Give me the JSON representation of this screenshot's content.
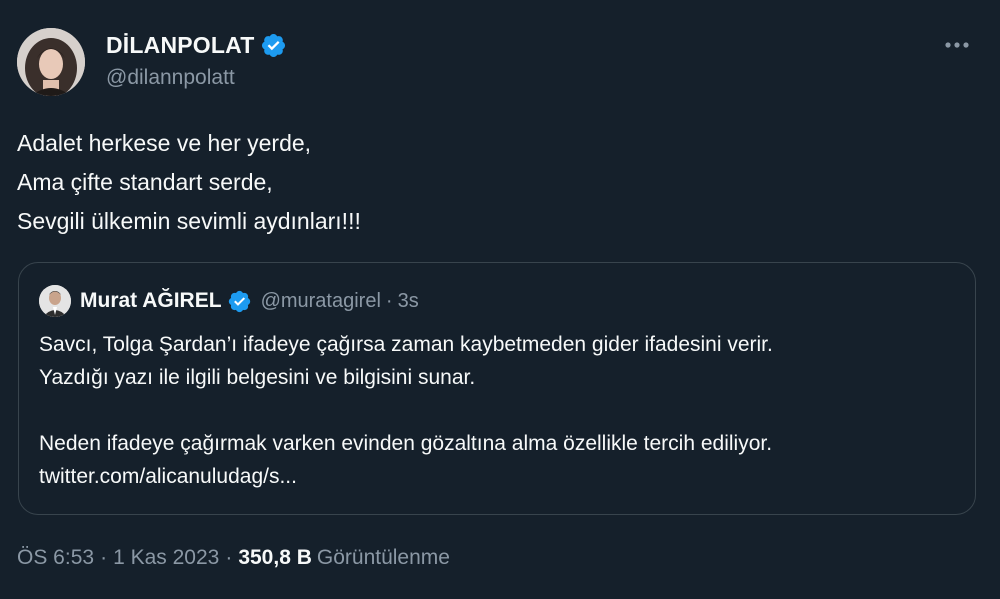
{
  "author": {
    "name": "DİLANPOLAT",
    "handle": "@dilannpolatt",
    "verified": true
  },
  "tweet": {
    "lines": [
      "Adalet herkese ve her yerde,",
      "Ama çifte standart serde,",
      "Sevgili ülkemin sevimli aydınları!!!"
    ]
  },
  "quote": {
    "name": "Murat AĞIREL",
    "handle": "@muratagirel",
    "separator": "·",
    "time": "3s",
    "lines": [
      "Savcı, Tolga Şardan’ı ifadeye çağırsa zaman kaybetmeden gider ifadesini verir.",
      "Yazdığı yazı ile ilgili belgesini ve bilgisini sunar.",
      "",
      "Neden ifadeye çağırmak varken evinden gözaltına alma özellikle tercih ediliyor.",
      "twitter.com/alicanuludag/s..."
    ]
  },
  "meta": {
    "time": "ÖS 6:53",
    "separator1": "·",
    "date": "1 Kas 2023",
    "separator2": "·",
    "views_count": "350,8 B",
    "views_label": "Görüntülenme"
  },
  "icons": {
    "verified": "verified-badge-icon",
    "more": "more-horizontal-icon"
  },
  "colors": {
    "background": "#15202b",
    "verified": "#1d9bf0",
    "secondary_text": "#8b98a5",
    "border": "#38444d"
  }
}
